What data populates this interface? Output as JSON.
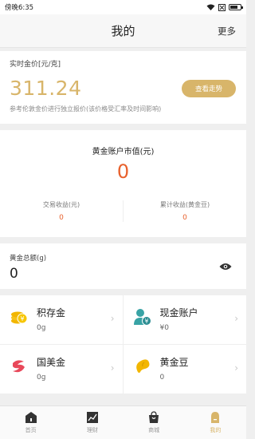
{
  "status_bar": {
    "time": "傍晚6:35",
    "battery_level": 0.75
  },
  "header": {
    "title": "我的",
    "more_label": "更多"
  },
  "price_card": {
    "label": "实时金价[元/克]",
    "price": "311.24",
    "trend_button": "查看走势",
    "note": "参考伦敦金价进行独立报价(该价格受汇率及时间影响)"
  },
  "account_card": {
    "title": "黄金账户市值(元)",
    "value": "0",
    "stats": [
      {
        "label": "交易收益(元)",
        "value": "0"
      },
      {
        "label": "累计收益(黄金豆)",
        "value": "0"
      }
    ]
  },
  "total_card": {
    "label": "黄金总额(g)",
    "value": "0"
  },
  "grid_items": [
    {
      "name": "积存金",
      "value": "0g",
      "icon": "coins-icon"
    },
    {
      "name": "现金账户",
      "value": "¥0",
      "icon": "user-yuan-icon"
    },
    {
      "name": "国美金",
      "value": "0g",
      "icon": "gome-logo-icon"
    },
    {
      "name": "黄金豆",
      "value": "0",
      "icon": "bean-icon"
    }
  ],
  "tabbar": [
    {
      "label": "首页",
      "icon": "home-icon"
    },
    {
      "label": "理财",
      "icon": "chart-icon"
    },
    {
      "label": "商城",
      "icon": "shopping-bag-icon"
    },
    {
      "label": "我的",
      "icon": "profile-icon",
      "active": true
    }
  ],
  "colors": {
    "gold": "#d8b56a",
    "orange": "#e8612d",
    "teal": "#38a3a5",
    "red": "#e8485a",
    "yellow": "#f2b600"
  }
}
